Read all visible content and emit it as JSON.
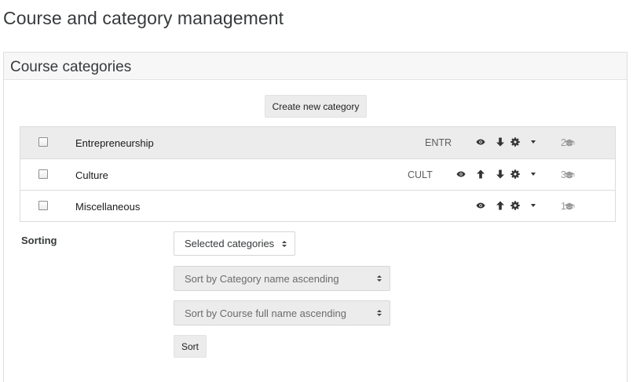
{
  "page": {
    "title": "Course and category management"
  },
  "panel": {
    "title": "Course categories",
    "create_button": "Create new category"
  },
  "categories": [
    {
      "name": "Entrepreneurship",
      "idnumber": "ENTR",
      "count": "2"
    },
    {
      "name": "Culture",
      "idnumber": "CULT",
      "count": "3"
    },
    {
      "name": "Miscellaneous",
      "idnumber": "",
      "count": "1"
    }
  ],
  "sorting": {
    "label": "Sorting",
    "scope_select": "Selected categories",
    "category_sort_select": "Sort by Category name ascending",
    "course_sort_select": "Sort by Course full name ascending",
    "sort_button": "Sort"
  },
  "icons": {
    "row_actions": [
      "eye-icon",
      "arrow-up-icon",
      "arrow-down-icon",
      "cog-icon",
      "caret-down-icon"
    ],
    "course_count_icon": "graduation-cap-icon"
  },
  "colors": {
    "header_bg": "#f7f7f7",
    "row_highlight": "#ececec",
    "button_bg": "#ececec"
  }
}
